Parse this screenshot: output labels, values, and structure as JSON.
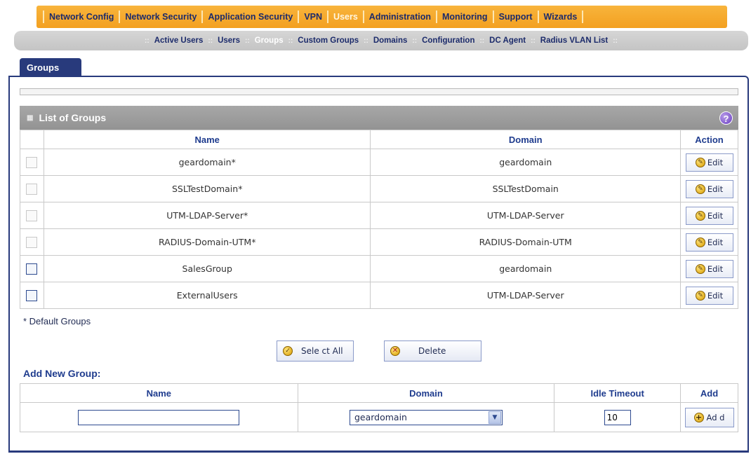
{
  "top_nav": {
    "items": [
      "Network Config",
      "Network Security",
      "Application Security",
      "VPN",
      "Users",
      "Administration",
      "Monitoring",
      "Support",
      "Wizards"
    ],
    "active": "Users"
  },
  "sub_nav": {
    "items": [
      "Active Users",
      "Users",
      "Groups",
      "Custom Groups",
      "Domains",
      "Configuration",
      "DC Agent",
      "Radius VLAN List"
    ],
    "active": "Groups"
  },
  "tab": {
    "label": "Groups"
  },
  "list": {
    "title": "List of Groups",
    "help_icon": "?",
    "headers": {
      "name": "Name",
      "domain": "Domain",
      "action": "Action"
    },
    "rows": [
      {
        "name": "geardomain*",
        "domain": "geardomain",
        "edit": "Edit",
        "default": true
      },
      {
        "name": "SSLTestDomain*",
        "domain": "SSLTestDomain",
        "edit": "Edit",
        "default": true
      },
      {
        "name": "UTM-LDAP-Server*",
        "domain": "UTM-LDAP-Server",
        "edit": "Edit",
        "default": true
      },
      {
        "name": "RADIUS-Domain-UTM*",
        "domain": "RADIUS-Domain-UTM",
        "edit": "Edit",
        "default": true
      },
      {
        "name": "SalesGroup",
        "domain": "geardomain",
        "edit": "Edit",
        "default": false
      },
      {
        "name": "ExternalUsers",
        "domain": "UTM-LDAP-Server",
        "edit": "Edit",
        "default": false
      }
    ],
    "default_note": "* Default Groups"
  },
  "buttons": {
    "select_all": "Sele ct All",
    "delete": "Delete"
  },
  "add_group": {
    "title": "Add New Group:",
    "headers": {
      "name": "Name",
      "domain": "Domain",
      "idle_timeout": "Idle Timeout",
      "add": "Add"
    },
    "name_value": "",
    "domain_selected": "geardomain",
    "idle_timeout_value": "10",
    "add_label": "Ad d"
  },
  "colors": {
    "top_nav": "#f3a020",
    "tab": "#283a7c",
    "header_text": "#1f3c8e"
  },
  "icons": {
    "edit": "edit-pencil-icon",
    "select_all": "check-icon",
    "delete": "cancel-x-icon",
    "add": "plus-icon",
    "help": "help-icon"
  }
}
